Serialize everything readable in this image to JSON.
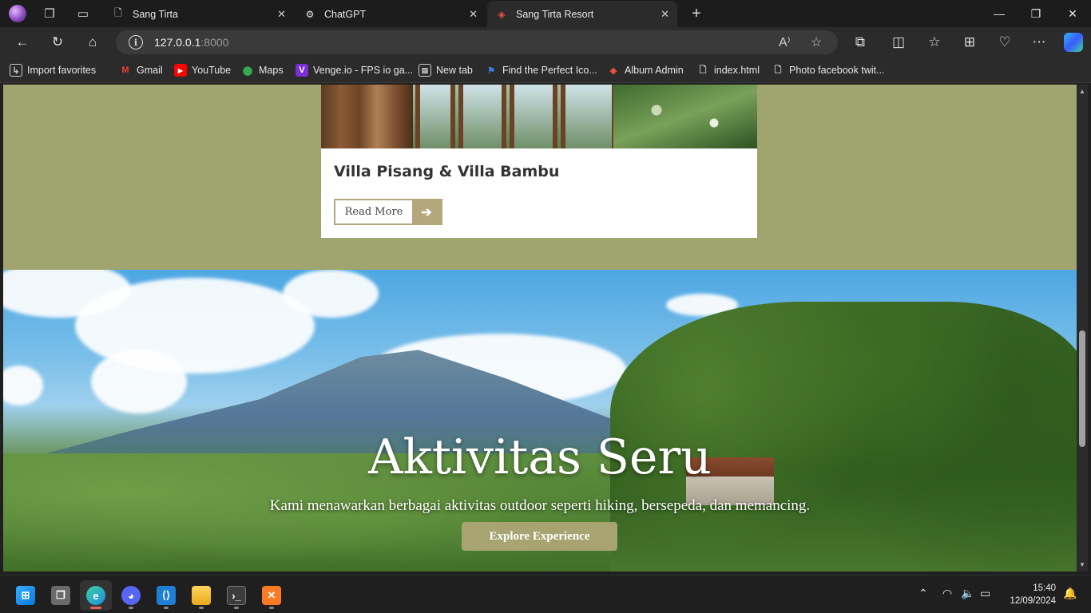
{
  "browser": {
    "tabs": [
      {
        "title": "Sang Tirta",
        "favicon": "page-icon",
        "active": false
      },
      {
        "title": "ChatGPT",
        "favicon": "chatgpt-icon",
        "active": false
      },
      {
        "title": "Sang Tirta Resort",
        "favicon": "laravel-icon",
        "active": true
      }
    ],
    "address": {
      "host": "127.0.0.1",
      "port": ":8000"
    },
    "favorites": [
      {
        "label": "Import favorites",
        "icon": "import-icon"
      },
      {
        "label": "Gmail",
        "icon": "gmail-icon"
      },
      {
        "label": "YouTube",
        "icon": "youtube-icon"
      },
      {
        "label": "Maps",
        "icon": "maps-icon"
      },
      {
        "label": "Venge.io - FPS io ga...",
        "icon": "venge-icon"
      },
      {
        "label": "New tab",
        "icon": "newtab-icon"
      },
      {
        "label": "Find the Perfect Ico...",
        "icon": "flag-icon"
      },
      {
        "label": "Album Admin",
        "icon": "laravel-icon"
      },
      {
        "label": "index.html",
        "icon": "file-icon"
      },
      {
        "label": "Photo facebook twit...",
        "icon": "file-icon"
      }
    ]
  },
  "page": {
    "card": {
      "title": "Villa Pisang & Villa Bambu",
      "button_label": "Read More"
    },
    "hero": {
      "title": "Aktivitas Seru",
      "subtitle": "Kami menawarkan berbagai aktivitas outdoor seperti hiking, bersepeda, dan memancing.",
      "button_label": "Explore Experience"
    },
    "colors": {
      "section_bg": "#a0a46e",
      "accent": "#b5a77d",
      "hero_button": "#a7a471"
    }
  },
  "taskbar": {
    "apps": [
      "windows-start",
      "task-view",
      "edge",
      "discord",
      "vscode",
      "file-explorer",
      "terminal",
      "xampp"
    ],
    "clock": {
      "time": "15:40",
      "date": "12/09/2024"
    }
  }
}
